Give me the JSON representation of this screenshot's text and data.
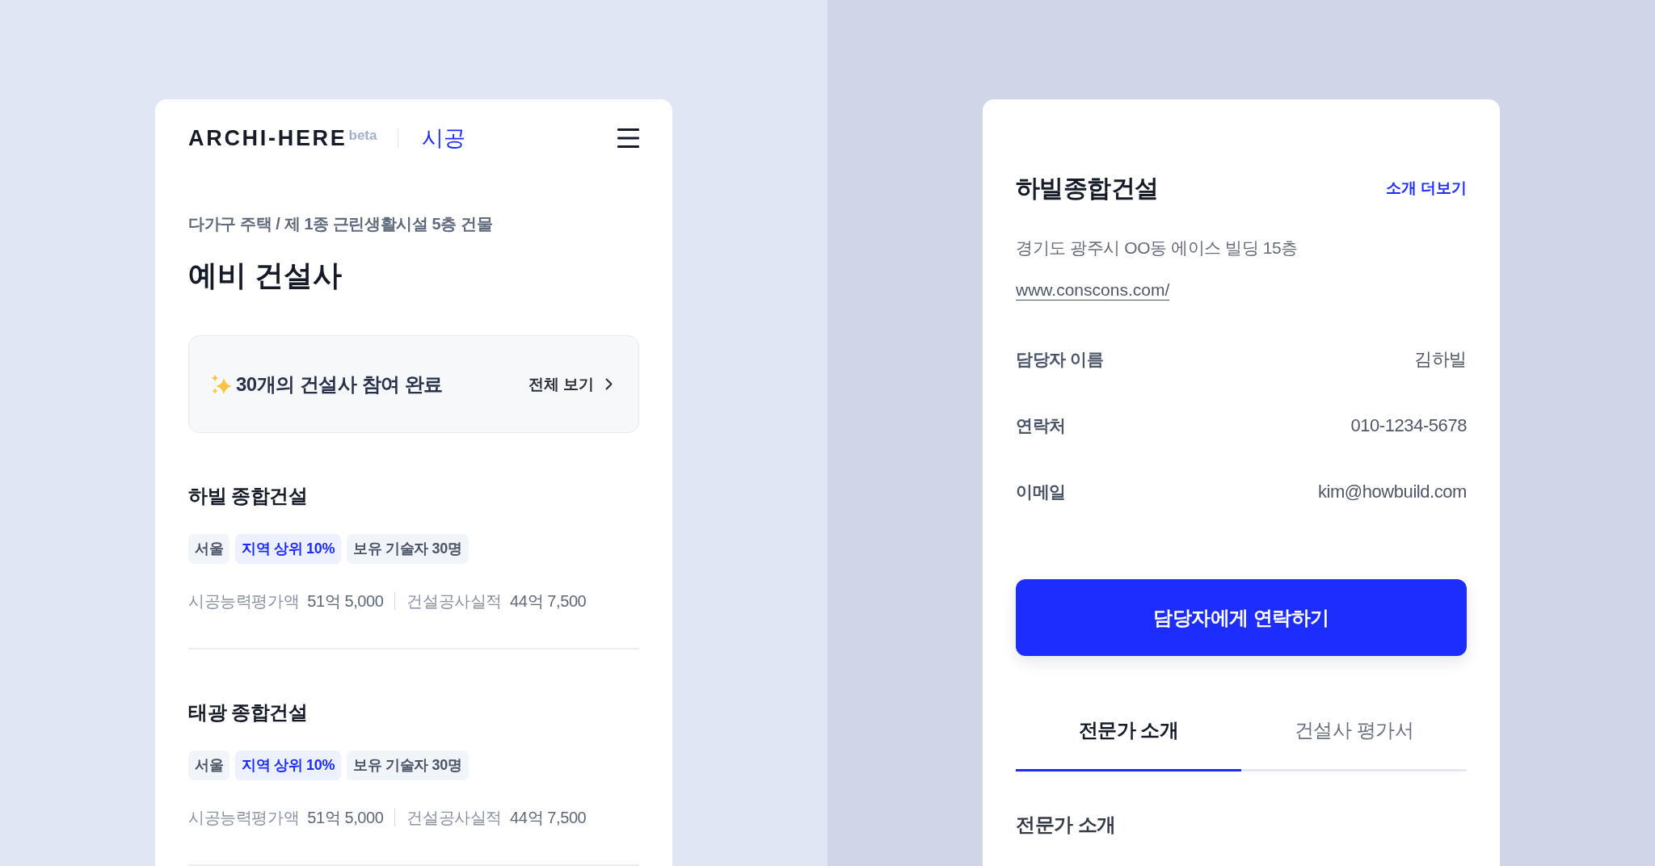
{
  "left_panel": {
    "header": {
      "logo": "ARCHI-HERE",
      "logo_badge": "beta",
      "section": "시공"
    },
    "breadcrumb": "다가구 주택 / 제 1종 근린생활시설 5층 건물",
    "title": "예비 건설사",
    "summary": {
      "text": "30개의 건설사 참여 완료",
      "link": "전체 보기"
    },
    "companies": [
      {
        "name": "하빌 종합건설",
        "tags": [
          {
            "label": "서울",
            "highlighted": false
          },
          {
            "label": "지역 상위 10%",
            "highlighted": true
          },
          {
            "label": "보유 기술자 30명",
            "highlighted": false
          }
        ],
        "stats": [
          {
            "label": "시공능력평가액",
            "value": "51억 5,000"
          },
          {
            "label": "건설공사실적",
            "value": "44억 7,500"
          }
        ]
      },
      {
        "name": "태광 종합건설",
        "tags": [
          {
            "label": "서울",
            "highlighted": false
          },
          {
            "label": "지역 상위 10%",
            "highlighted": true
          },
          {
            "label": "보유 기술자 30명",
            "highlighted": false
          }
        ],
        "stats": [
          {
            "label": "시공능력평가액",
            "value": "51억 5,000"
          },
          {
            "label": "건설공사실적",
            "value": "44억 7,500"
          }
        ]
      }
    ]
  },
  "right_panel": {
    "company": {
      "name": "하빌종합건설",
      "more_link": "소개 더보기",
      "address": "경기도 광주시 OO동 에이스 빌딩 15층",
      "website": "www.conscons.com/"
    },
    "contacts": [
      {
        "label": "담당자 이름",
        "value": "김하빌"
      },
      {
        "label": "연락처",
        "value": "010-1234-5678"
      },
      {
        "label": "이메일",
        "value": "kim@howbuild.com"
      }
    ],
    "contact_button": "담당자에게 연락하기",
    "tabs": [
      {
        "label": "전문가 소개",
        "selected": true
      },
      {
        "label": "건설사 평가서",
        "selected": false
      }
    ],
    "section_heading": "전문가 소개"
  }
}
